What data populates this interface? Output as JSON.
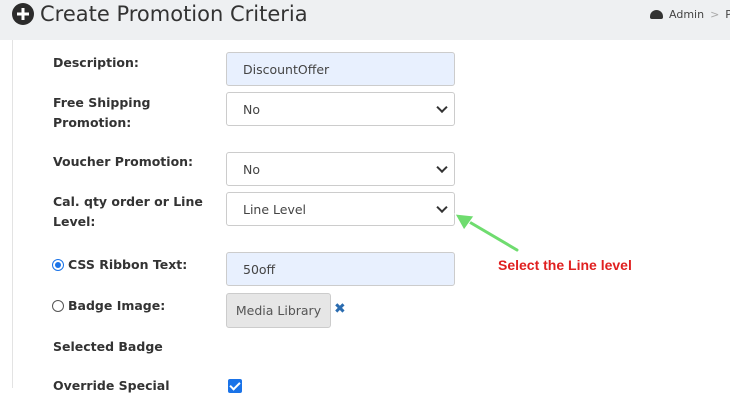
{
  "header": {
    "title": "Create Promotion Criteria",
    "breadcrumb": [
      "Admin",
      "P"
    ]
  },
  "form": {
    "description_label": "Description:",
    "description_value": "DiscountOffer",
    "free_shipping_label_line1": "Free Shipping",
    "free_shipping_label_line2": "Promotion:",
    "free_shipping_value": "No",
    "voucher_label": "Voucher Promotion:",
    "voucher_value": "No",
    "cal_qty_label_line1": "Cal. qty order or Line",
    "cal_qty_label_line2": "Level:",
    "cal_qty_value": "Line Level",
    "css_ribbon_label": "CSS Ribbon Text:",
    "css_ribbon_value": "50off",
    "css_ribbon_selected": true,
    "badge_image_label": "Badge Image:",
    "badge_image_selected": false,
    "media_library_label": "Media Library",
    "selected_badge_label": "Selected Badge",
    "override_special_label": "Override Special",
    "override_special_checked": true
  },
  "annotation": {
    "callout_text": "Select the Line level",
    "callout_color": "#e02020",
    "arrow_color": "#6fdc6f"
  },
  "colors": {
    "accent": "#1a73e8",
    "filled_input": "#e8f0fe",
    "topbar": "#eef0f2"
  },
  "icons": {
    "title_icon": "plus-circle-icon",
    "breadcrumb_icon": "dashboard-icon",
    "remove_badge_icon": "close-icon",
    "select_arrow_icon": "chevron-down-icon"
  }
}
